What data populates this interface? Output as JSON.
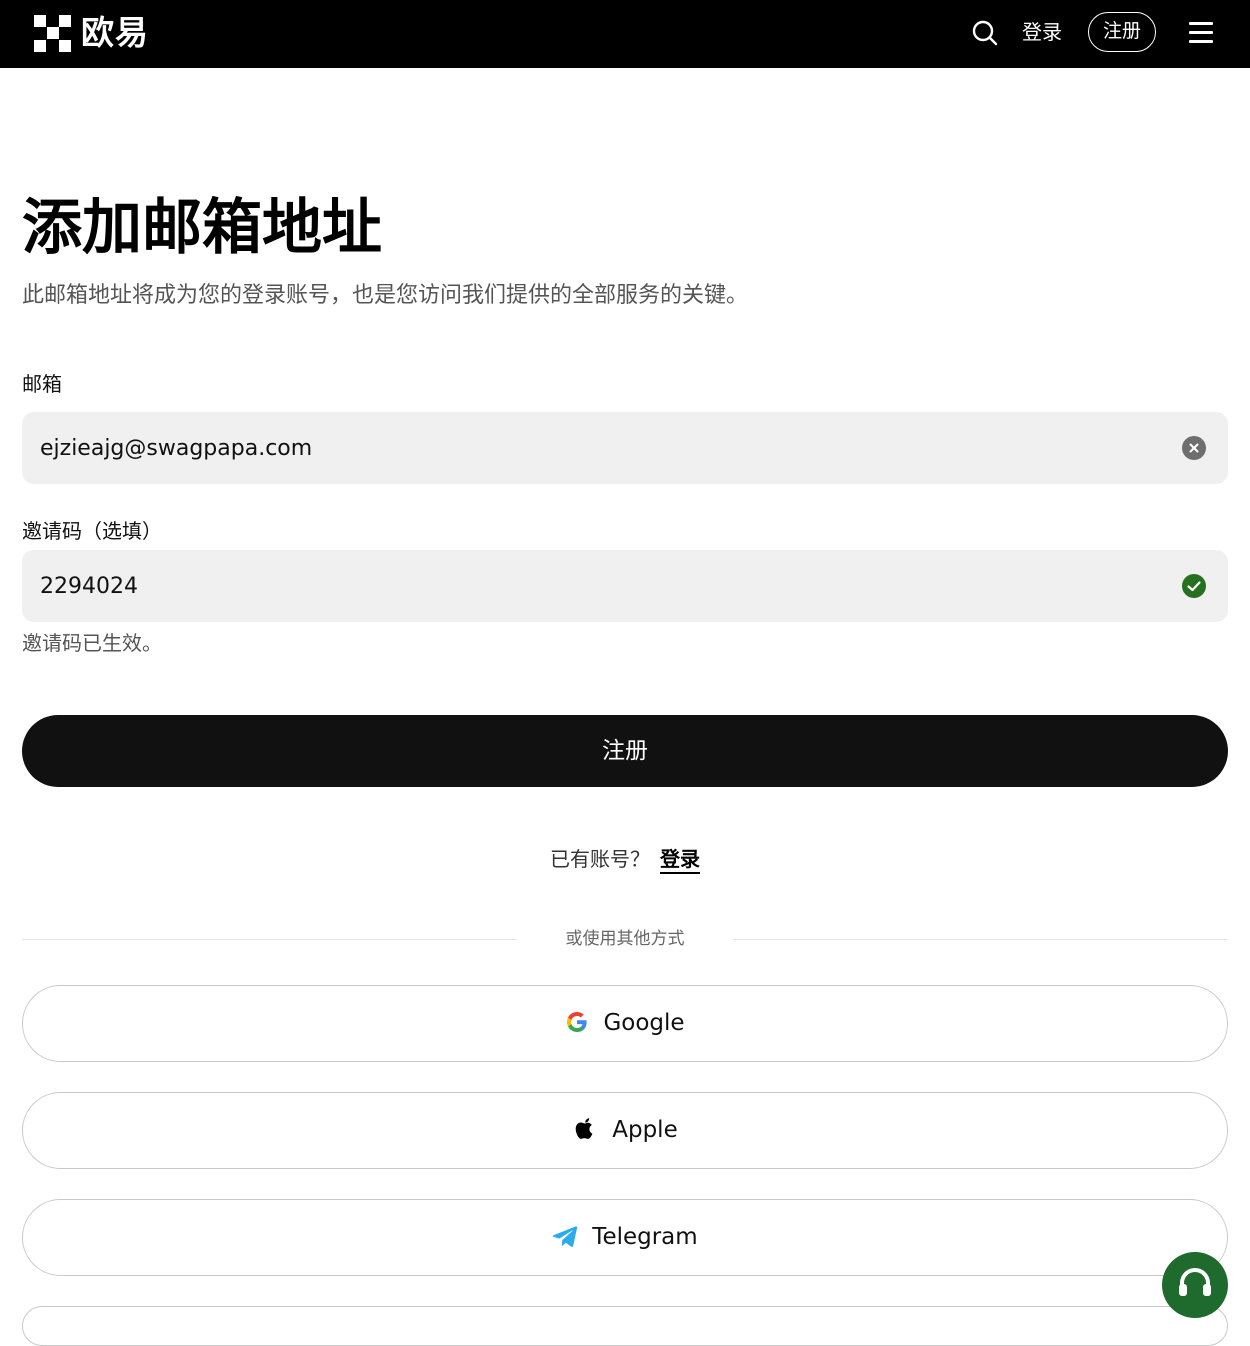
{
  "nav": {
    "logo_text": "欧易",
    "login_label": "登录",
    "register_label": "注册"
  },
  "page": {
    "title": "添加邮箱地址",
    "subtitle": "此邮箱地址将成为您的登录账号，也是您访问我们提供的全部服务的关键。"
  },
  "email": {
    "label": "邮箱",
    "value": "ejzieajg@swagpapa.com"
  },
  "invite": {
    "label": "邀请码（选填）",
    "value": "2294024",
    "status_text": "邀请码已生效。"
  },
  "submit_label": "注册",
  "have_account": {
    "text": "已有账号？",
    "login_link": "登录"
  },
  "divider_text": "或使用其他方式",
  "oauth": [
    {
      "label": "Google",
      "icon": "google-icon"
    },
    {
      "label": "Apple",
      "icon": "apple-icon"
    },
    {
      "label": "Telegram",
      "icon": "telegram-icon"
    }
  ],
  "colors": {
    "topbar_bg": "#000000",
    "primary_button": "#111111",
    "input_bg": "#f0f0f0",
    "success": "#26701f",
    "support_fab": "#1f6b2e"
  }
}
